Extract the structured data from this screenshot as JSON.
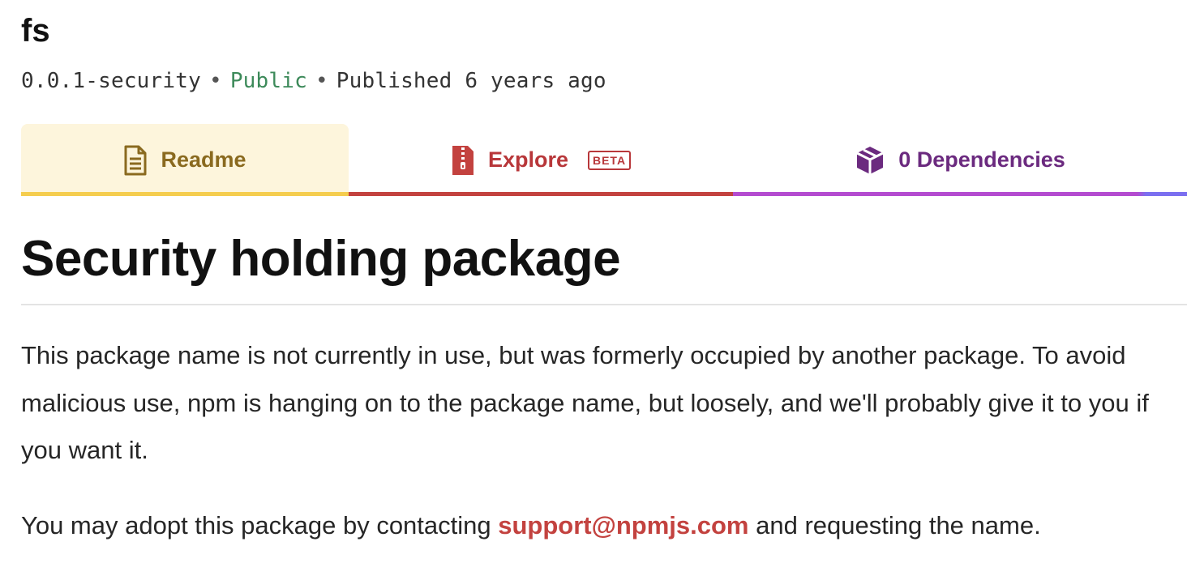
{
  "package": {
    "name": "fs",
    "version": "0.0.1-security",
    "visibility": "Public",
    "published": "Published 6 years ago",
    "separator": "•"
  },
  "tabs": [
    {
      "label": "Readme",
      "icon": "readme-document-icon",
      "color": "#8a6a1f",
      "active": true
    },
    {
      "label": "Explore",
      "icon": "zip-file-icon",
      "badge": "BETA",
      "color": "#b8373a"
    },
    {
      "label": "0 Dependencies",
      "icon": "box-icon",
      "color": "#6b2a7f"
    }
  ],
  "readme": {
    "title": "Security holding package",
    "paragraph1": "This package name is not currently in use, but was formerly occupied by another package. To avoid malicious use, npm is hanging on to the package name, but loosely, and we'll probably give it to you if you want it.",
    "paragraph2_before": "You may adopt this package by contacting ",
    "paragraph2_link": "support@npmjs.com",
    "paragraph2_after": " and requesting the name."
  },
  "colors": {
    "public": "#3d8a5a",
    "link": "#c3423f",
    "readme_tab_bg": "#fdf5dc",
    "readme_tab_border": "#f5cd4e"
  }
}
